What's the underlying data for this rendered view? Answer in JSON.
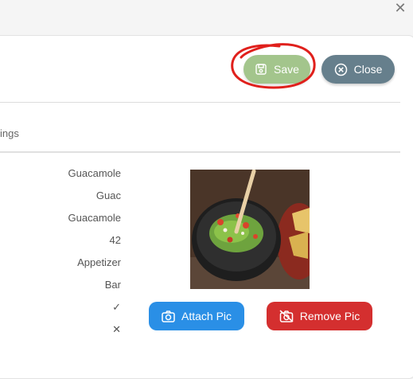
{
  "dialog": {
    "close_glyph": "✕"
  },
  "toolbar": {
    "save_label": "Save",
    "close_label": "Close"
  },
  "tab": {
    "label": "ings"
  },
  "fields": [
    "Guacamole",
    "Guac",
    "Guacamole",
    "42",
    "Appetizer",
    "Bar"
  ],
  "flags": {
    "checked_glyph": "✓",
    "unchecked_glyph": "✕"
  },
  "image_actions": {
    "attach_label": "Attach Pic",
    "remove_label": "Remove Pic"
  },
  "colors": {
    "save": "#a3c58c",
    "close": "#667f8c",
    "attach": "#2a8fe6",
    "remove": "#d42f2f",
    "annotation": "#e0201c"
  },
  "icons": [
    "dialog-close-icon",
    "save-icon",
    "close-circle-icon",
    "camera-icon",
    "camera-off-icon"
  ]
}
